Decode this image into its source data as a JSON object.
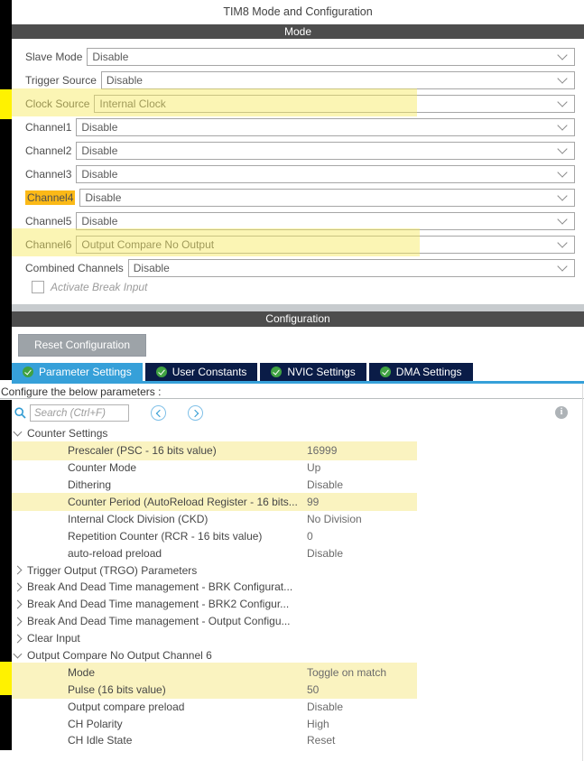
{
  "title": "TIM8 Mode and Configuration",
  "mode_section": {
    "header": "Mode",
    "rows": [
      {
        "label": "Slave Mode",
        "value": "Disable"
      },
      {
        "label": "Trigger Source",
        "value": "Disable"
      },
      {
        "label": "Clock Source",
        "value": "Internal Clock",
        "annotation": "yellow-highlight"
      },
      {
        "label": "Channel1",
        "value": "Disable"
      },
      {
        "label": "Channel2",
        "value": "Disable"
      },
      {
        "label": "Channel3",
        "value": "Disable"
      },
      {
        "label": "Channel4",
        "value": "Disable",
        "annotation": "orange-label-highlight"
      },
      {
        "label": "Channel5",
        "value": "Disable"
      },
      {
        "label": "Channel6",
        "value": "Output Compare No Output",
        "annotation": "yellow-highlight"
      },
      {
        "label": "Combined Channels",
        "value": "Disable"
      }
    ],
    "break_input_checkbox": {
      "label": "Activate Break Input",
      "checked": false
    }
  },
  "configuration_section": {
    "header": "Configuration",
    "reset_button_label": "Reset Configuration",
    "tabs": [
      {
        "label": "Parameter Settings",
        "active": true
      },
      {
        "label": "User Constants",
        "active": false
      },
      {
        "label": "NVIC Settings",
        "active": false
      },
      {
        "label": "DMA Settings",
        "active": false
      }
    ],
    "hint": "Configure the below parameters :",
    "search_placeholder": "Search (Ctrl+F)",
    "info_icon_glyph": "i"
  },
  "parameters_tree": {
    "rows": [
      {
        "type": "group",
        "label": "Counter Settings",
        "expanded": true
      },
      {
        "type": "param",
        "label": "Prescaler (PSC - 16 bits value)",
        "value": "16999",
        "annotation": "yellow-highlight"
      },
      {
        "type": "param",
        "label": "Counter Mode",
        "value": "Up"
      },
      {
        "type": "param",
        "label": "Dithering",
        "value": "Disable"
      },
      {
        "type": "param",
        "label": "Counter Period (AutoReload Register - 16 bits...",
        "value": "99",
        "annotation": "yellow-highlight"
      },
      {
        "type": "param",
        "label": "Internal Clock Division (CKD)",
        "value": "No Division"
      },
      {
        "type": "param",
        "label": "Repetition Counter (RCR - 16 bits value)",
        "value": "0"
      },
      {
        "type": "param",
        "label": "auto-reload preload",
        "value": "Disable"
      },
      {
        "type": "group",
        "label": "Trigger Output (TRGO) Parameters",
        "expanded": false
      },
      {
        "type": "group",
        "label": "Break And Dead Time management - BRK Configurat...",
        "expanded": false
      },
      {
        "type": "group",
        "label": "Break And Dead Time management - BRK2 Configur...",
        "expanded": false
      },
      {
        "type": "group",
        "label": "Break And Dead Time management - Output Configu...",
        "expanded": false
      },
      {
        "type": "group",
        "label": "Clear Input",
        "expanded": false
      },
      {
        "type": "group",
        "label": "Output Compare No Output Channel 6",
        "expanded": true
      },
      {
        "type": "param",
        "label": "Mode",
        "value": "Toggle on match",
        "annotation": "yellow-highlight"
      },
      {
        "type": "param",
        "label": "Pulse (16 bits value)",
        "value": "50",
        "annotation": "yellow-highlight"
      },
      {
        "type": "param",
        "label": "Output compare preload",
        "value": "Disable"
      },
      {
        "type": "param",
        "label": "CH Polarity",
        "value": "High"
      },
      {
        "type": "param",
        "label": "CH Idle State",
        "value": "Reset"
      }
    ]
  },
  "icons": {
    "tab_check": "green-check-circle",
    "search": "magnifier",
    "prev": "chevron-left-circle",
    "next": "chevron-right-circle",
    "info": "info-circle",
    "dropdown": "chevron-down",
    "tree_expanded": "chevron-down",
    "tree_collapsed": "chevron-right"
  },
  "colors": {
    "header_bar": "#4d4d4d",
    "active_tab": "#36a0d9",
    "inactive_tab": "#0a1c47",
    "highlight_band": "#faf3c0",
    "marker_yellow": "#fff200",
    "channel4_highlight": "#fbb917",
    "check_green": "#3fa142",
    "reset_button": "#9da3a8"
  }
}
